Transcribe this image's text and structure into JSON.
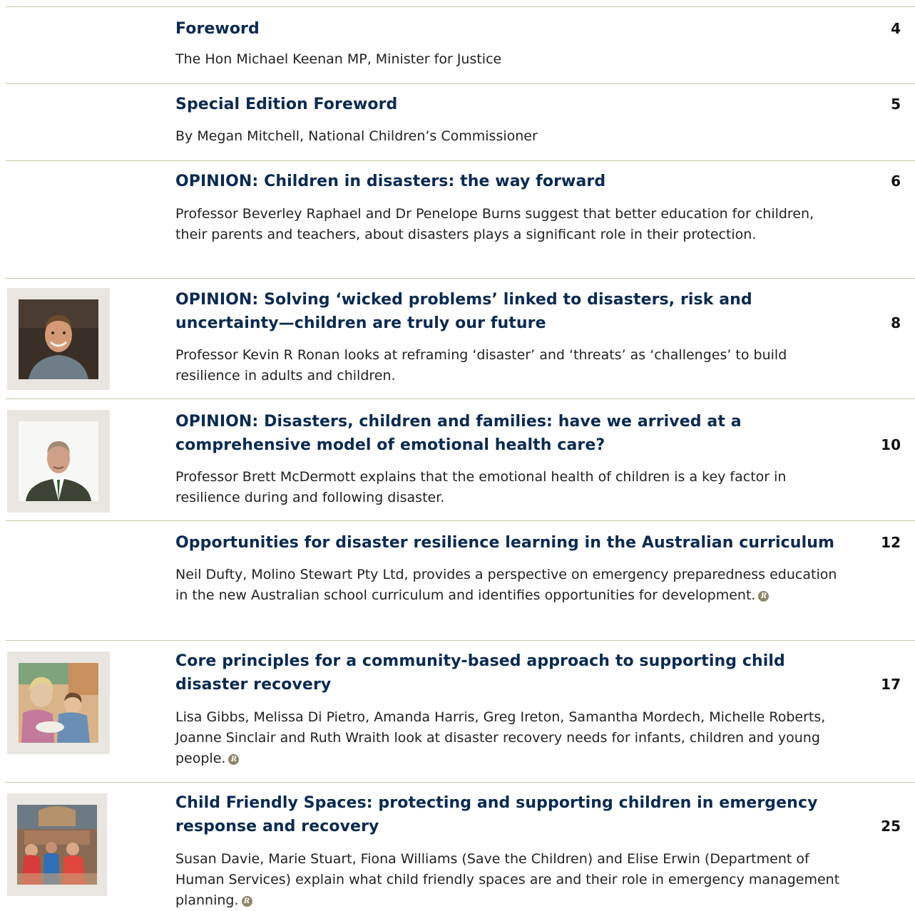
{
  "toc": {
    "entries": [
      {
        "title": "Foreword",
        "page": "4",
        "description": "The Hon Michael Keenan MP, Minister for Justice"
      },
      {
        "title": "Special Edition Foreword",
        "page": "5",
        "description": "By Megan Mitchell, National Children’s Commissioner"
      },
      {
        "title": "OPINION: Children in disasters: the way forward",
        "page": "6",
        "description": "Professor Beverley Raphael and Dr Penelope Burns suggest that better education for children, their parents and teachers, about disasters plays a significant role in their protection."
      },
      {
        "title": "OPINION: Solving ‘wicked problems’ linked to disasters, risk and uncertainty—children are truly our future",
        "page": "8",
        "description": "Professor Kevin R Ronan looks at reframing ‘disaster’ and ‘threats’ as ‘challenges’ to build resilience in adults and children."
      },
      {
        "title": "OPINION: Disasters, children and families: have we arrived at a comprehensive model of emotional health care?",
        "page": "10",
        "description": "Professor Brett McDermott explains that the emotional health of children is a key factor in resilience during and following disaster."
      },
      {
        "title": "Opportunities for disaster resilience learning in the Australian curriculum",
        "page": "12",
        "description": "Neil Dufty, Molino Stewart Pty Ltd, provides a perspective on emergency preparedness education in the new Australian school curriculum and identifies opportunities for development."
      },
      {
        "title": "Core principles for a community-based approach to supporting child disaster recovery",
        "page": "17",
        "description": "Lisa Gibbs, Melissa Di Pietro, Amanda Harris, Greg Ireton, Samantha Mordech, Michelle Roberts, Joanne Sinclair and Ruth Wraith look at disaster recovery needs for infants, children and young people."
      },
      {
        "title": "Child Friendly Spaces: protecting and supporting children in emergency response and recovery",
        "page": "25",
        "description": "Susan Davie, Marie Stuart, Fiona Williams (Save the Children) and Elise Erwin (Department of Human Services) explain what child friendly spaces are and their role in emergency management planning."
      }
    ],
    "refereed_icon": "refereed-r-icon",
    "refereed_glyph": "R",
    "colors": {
      "title": "#0a2a52",
      "rule": "#c8c6a4",
      "icon": "#8d8569"
    }
  }
}
